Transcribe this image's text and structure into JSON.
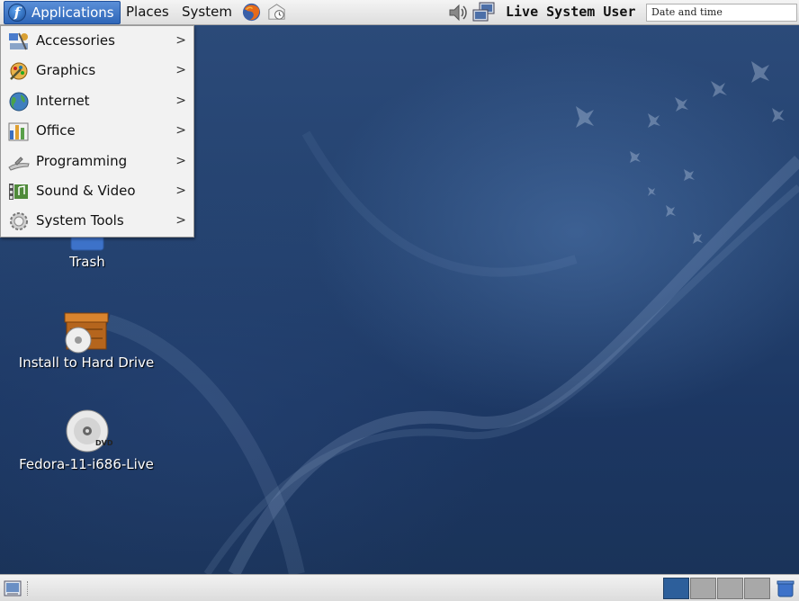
{
  "top_panel": {
    "applications_label": "Applications",
    "places_label": "Places",
    "system_label": "System",
    "user_name": "Live System User",
    "clock_text": "Date and time",
    "icons": {
      "logo": "fedora-logo-icon",
      "browser": "firefox-icon",
      "mail": "evolution-mail-icon",
      "volume": "volume-icon",
      "network": "network-icon"
    }
  },
  "applications_menu": {
    "items": [
      {
        "label": "Accessories",
        "icon": "accessories-icon"
      },
      {
        "label": "Graphics",
        "icon": "graphics-icon"
      },
      {
        "label": "Internet",
        "icon": "internet-icon"
      },
      {
        "label": "Office",
        "icon": "office-icon"
      },
      {
        "label": "Programming",
        "icon": "programming-icon"
      },
      {
        "label": "Sound & Video",
        "icon": "sound-video-icon"
      },
      {
        "label": "System Tools",
        "icon": "system-tools-icon"
      }
    ],
    "submenu_arrow": ">"
  },
  "desktop": {
    "icons": [
      {
        "label": "Trash",
        "icon": "trash-icon"
      },
      {
        "label": "Install to Hard Drive",
        "icon": "install-icon"
      },
      {
        "label": "Fedora-11-i686-Live",
        "icon": "dvd-icon",
        "badge": "DVD"
      }
    ]
  },
  "bottom_panel": {
    "workspace_count": 4,
    "active_workspace": 1,
    "icons": {
      "show_desktop": "show-desktop-icon",
      "trash": "trash-applet-icon"
    }
  },
  "colors": {
    "panel_bg": "#e4e4e4",
    "menu_selected": "#3a72c4",
    "desktop_bg": "#24426f",
    "workspace_active": "#2d5f9b"
  }
}
